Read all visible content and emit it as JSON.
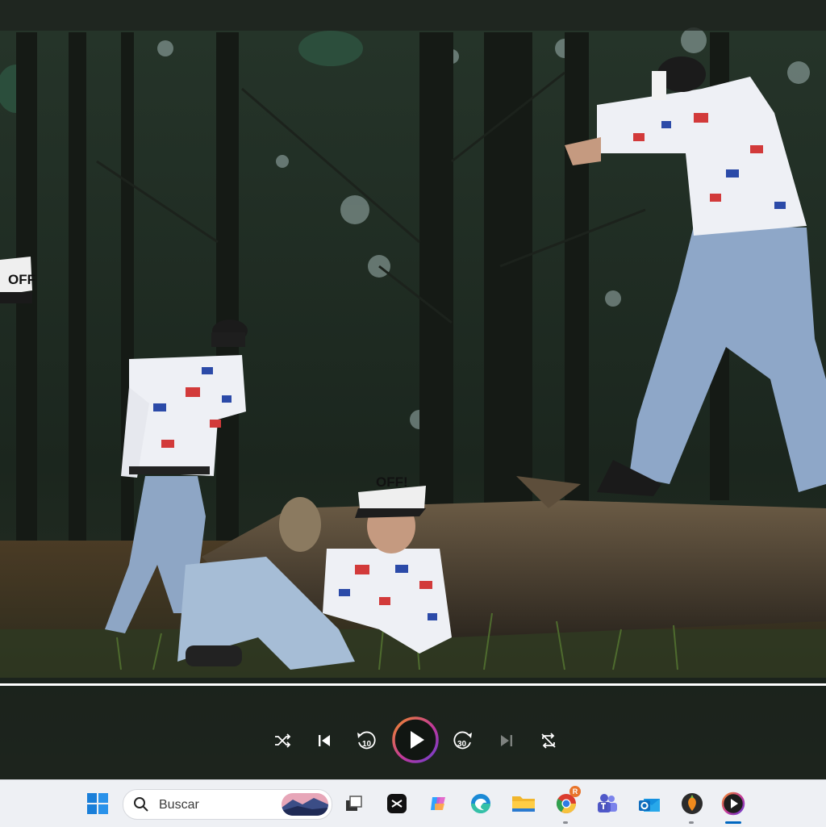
{
  "player": {
    "progress": 1.0,
    "controls": {
      "shuffle": "shuffle-icon",
      "previous": "skip-previous-icon",
      "rewind": {
        "icon": "rewind-icon",
        "seconds": "10"
      },
      "play": "play-icon",
      "forward": {
        "icon": "fast-forward-icon",
        "seconds": "30"
      },
      "next": "skip-next-icon",
      "repeat": "repeat-off-icon"
    },
    "accent_gradient": [
      "#f08a2a",
      "#c2379b",
      "#6a3fd0"
    ]
  },
  "video_frame": {
    "cap_text_left": "OFF",
    "cap_text_center": "OFF!"
  },
  "taskbar": {
    "search_placeholder": "Buscar",
    "notification_badge": "R",
    "apps": [
      "windows-start-icon",
      "search-icon",
      "task-view-icon",
      "capcut-icon",
      "copilot-icon",
      "edge-icon",
      "file-explorer-icon",
      "chrome-icon",
      "teams-icon",
      "outlook-icon",
      "fl-studio-icon",
      "media-player-icon"
    ]
  }
}
